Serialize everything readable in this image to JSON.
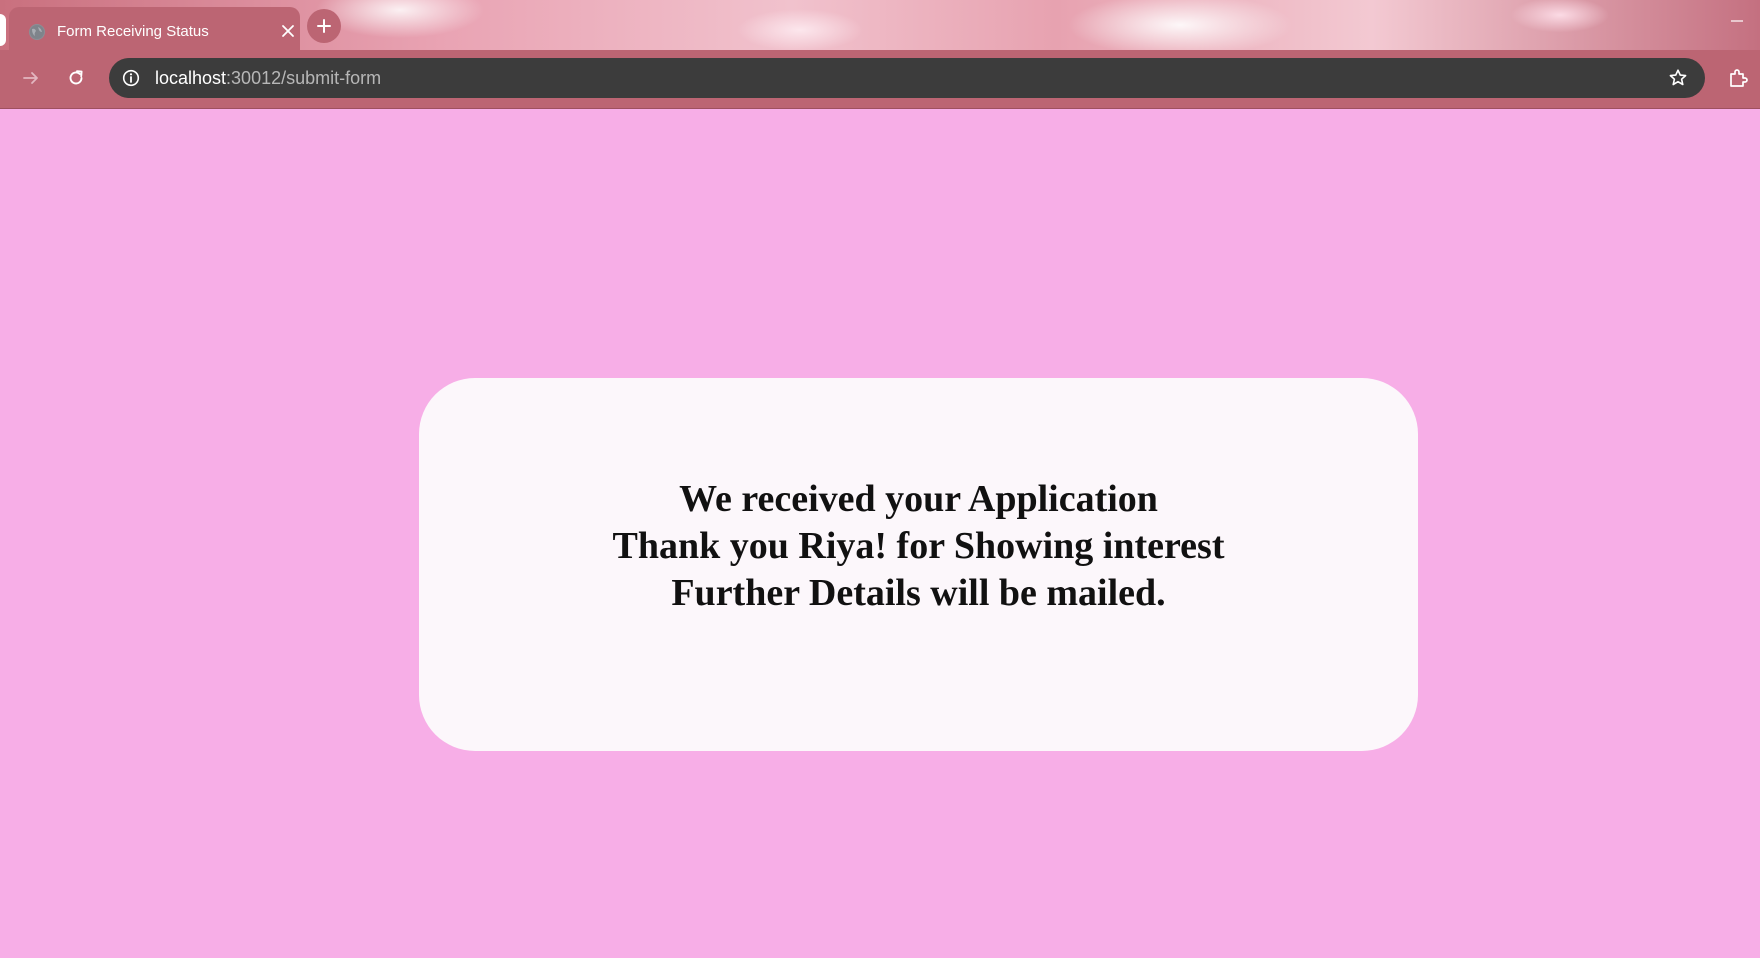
{
  "browser": {
    "tab": {
      "title": "Form Receiving Status",
      "favicon": "globe-icon",
      "close_icon": "close-icon"
    },
    "new_tab_icon": "plus-icon",
    "window_controls": {
      "minimize_icon": "minimize-icon"
    },
    "toolbar": {
      "forward_icon": "arrow-right-icon",
      "reload_icon": "reload-icon",
      "site_info_icon": "info-icon",
      "bookmark_icon": "star-icon",
      "extensions_icon": "puzzle-icon"
    },
    "address_bar": {
      "host": "localhost",
      "rest": ":30012/submit-form"
    }
  },
  "page": {
    "message": {
      "line1": "We received your Application",
      "line2": "Thank you Riya! for Showing interest",
      "line3": "Further Details will be mailed."
    }
  },
  "colors": {
    "page_background": "#f7aee7",
    "card_background": "#fcf7fb",
    "frame": "#bc6573",
    "omnibox": "#3c3c3c",
    "text": "#111111"
  }
}
